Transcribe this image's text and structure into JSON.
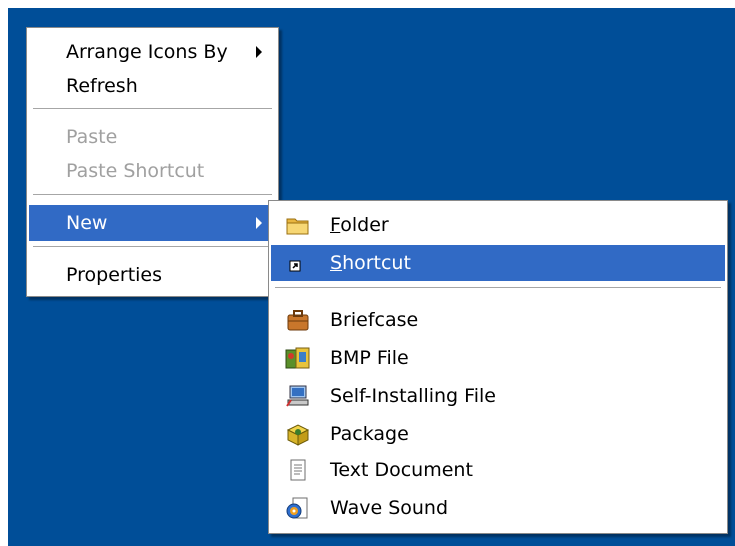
{
  "context_menu": {
    "items": [
      {
        "label": "Arrange Icons By",
        "has_submenu": true,
        "enabled": true
      },
      {
        "label": "Refresh",
        "enabled": true
      },
      {
        "label": "Paste",
        "enabled": false
      },
      {
        "label": "Paste Shortcut",
        "enabled": false
      },
      {
        "label": "New",
        "has_submenu": true,
        "enabled": true,
        "selected": true
      },
      {
        "label": "Properties",
        "enabled": true
      }
    ]
  },
  "new_submenu": {
    "items": [
      {
        "label_mnemonic": "F",
        "label_rest": "older",
        "icon": "folder-icon"
      },
      {
        "label_mnemonic": "S",
        "label_rest": "hortcut",
        "icon": "shortcut-icon",
        "selected": true
      },
      {
        "label": "Briefcase",
        "icon": "briefcase-icon"
      },
      {
        "label": "BMP File",
        "icon": "bmp-file-icon"
      },
      {
        "label": "Self-Installing File",
        "icon": "self-installing-file-icon"
      },
      {
        "label": "Package",
        "icon": "package-icon"
      },
      {
        "label": "Text Document",
        "icon": "text-document-icon"
      },
      {
        "label": "Wave Sound",
        "icon": "wave-sound-icon"
      }
    ]
  },
  "colors": {
    "desktop": "#004e98",
    "selection": "#316ac5"
  }
}
